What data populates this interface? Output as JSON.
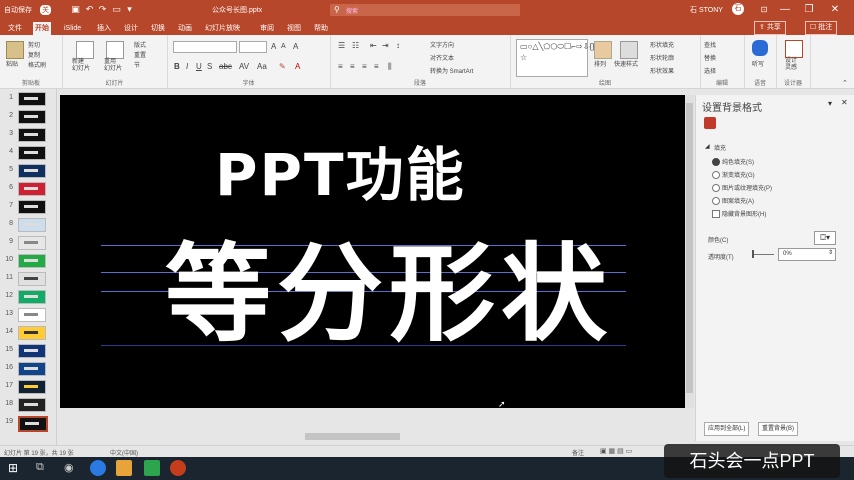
{
  "window": {
    "autosave": "自动保存",
    "autosave_state": "关",
    "filename": "公众号长图.pptx",
    "search_placeholder": "搜索",
    "user": "石 STONY",
    "avatar_initial": "石"
  },
  "tabs": [
    "文件",
    "开始",
    "iSlide",
    "插入",
    "设计",
    "切换",
    "动画",
    "幻灯片放映",
    "审阅",
    "视图",
    "帮助"
  ],
  "active_tab": "开始",
  "share_label": "共享",
  "comment_label": "批注",
  "ribbon": {
    "groups": [
      "剪贴板",
      "幻灯片",
      "字体",
      "段落",
      "绘图",
      "编辑"
    ],
    "paste": "粘贴",
    "cut": "剪切",
    "copy": "复制",
    "format_painter": "格式刷",
    "new_slide": "新建\n幻灯片",
    "reuse_slide": "重用\n幻灯片",
    "layout": "版式",
    "reset": "重置",
    "section": "节",
    "text_direction": "文字方向",
    "align_text": "对齐文本",
    "smartart": "转换为 SmartArt",
    "arrange": "排列",
    "quick_styles": "快速样式",
    "shape_fill": "形状填充",
    "shape_outline": "形状轮廓",
    "shape_effects": "形状效果",
    "find": "查找",
    "replace": "替换",
    "select": "选择",
    "voice": "听写",
    "voice_group": "语音",
    "design_ideas": "设计\n灵感",
    "designer": "设计器"
  },
  "thumbnails": [
    "1",
    "2",
    "3",
    "4",
    "5",
    "6",
    "7",
    "8",
    "9",
    "10",
    "11",
    "12",
    "13",
    "14",
    "15",
    "16",
    "17",
    "18",
    "19"
  ],
  "slide": {
    "line1": "PPT功能",
    "line2": "等分形状"
  },
  "format_pane": {
    "title": "设置背景格式",
    "section": "填充",
    "options": [
      "纯色填充(S)",
      "渐变填充(G)",
      "图片或纹理填充(P)",
      "图案填充(A)",
      "隐藏背景图形(H)"
    ],
    "color_label": "颜色(C)",
    "transparency_label": "透明度(T)",
    "transparency_value": "0%",
    "apply_all": "应用到全部(L)",
    "reset_background": "重置背景(B)"
  },
  "status": {
    "slide_info": "幻灯片 第 19 张，共 19 张",
    "language": "中文(中国)",
    "notes": "备注",
    "zoom": "73%"
  },
  "watermark": "石头会一点PPT"
}
